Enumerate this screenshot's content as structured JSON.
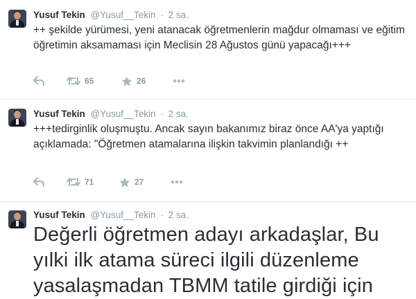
{
  "tweets": [
    {
      "name": "Yusuf Tekin",
      "handle": "@Yusuf__Tekin",
      "separator": "·",
      "time": "2 sa.",
      "text": "++ şekilde yürümesi, yeni atanacak öğretmenlerin mağdur olmaması ve eğitim öğretimin aksamaması için Meclisin 28 Ağustos günü yapacağı+++",
      "retweets": "65",
      "favorites": "26"
    },
    {
      "name": "Yusuf Tekin",
      "handle": "@Yusuf__Tekin",
      "separator": "·",
      "time": "2 sa.",
      "text": "+++tedirginlik oluşmuştu. Ancak sayın bakanımız biraz önce AA'ya yaptığı açıklamada: \"Öğretmen atamalarına ilişkin takvimin planlandığı ++",
      "retweets": "71",
      "favorites": "27"
    },
    {
      "name": "Yusuf Tekin",
      "handle": "@Yusuf__Tekin",
      "separator": "·",
      "time": "2 sa.",
      "text": "Değerli öğretmen adayı arkadaşlar, Bu yılki ilk atama süreci ilgili düzenleme yasalaşmadan TBMM tatile girdiği için"
    }
  ],
  "icons": {
    "reply": "reply-icon",
    "retweet": "retweet-icon",
    "favorite": "star-icon",
    "more": "more-icon"
  },
  "colors": {
    "icon": "#aab8c2",
    "meta": "#8899a6",
    "text": "#292f33",
    "separator": "#e1e8ed"
  }
}
